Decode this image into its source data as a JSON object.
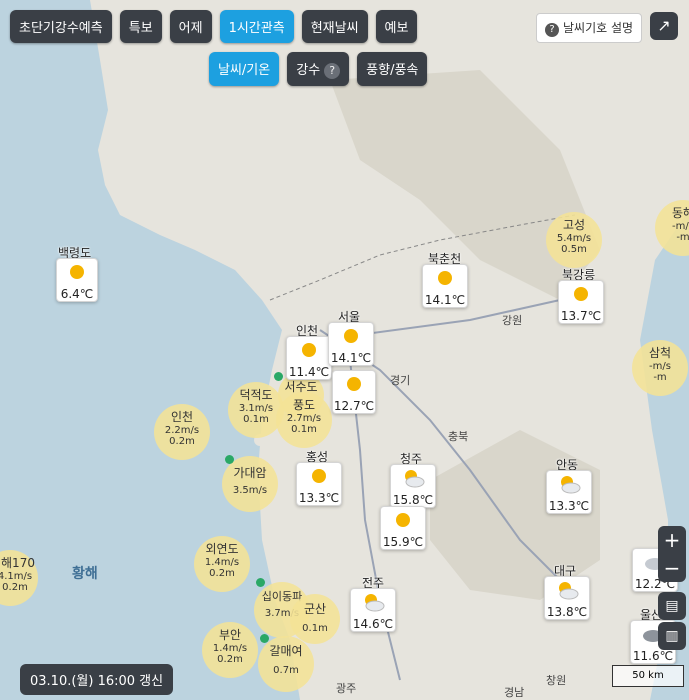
{
  "toolbar": {
    "buttons": [
      "초단기강수예측",
      "특보",
      "어제",
      "1시간관측",
      "현재날씨",
      "예보"
    ],
    "sub_buttons": [
      "날씨/기온",
      "강수",
      "풍향/풍속"
    ],
    "info_label": "날씨기호 설명"
  },
  "stations": [
    {
      "name": "백령도",
      "temp": "6.4℃",
      "icon": "sun-icon"
    },
    {
      "name": "인천",
      "temp": "11.4℃",
      "icon": "sun-icon"
    },
    {
      "name": "서울",
      "temp": "14.1℃",
      "icon": "sun-icon"
    },
    {
      "name": "",
      "temp": "12.7℃",
      "icon": "sun-icon"
    },
    {
      "name": "북춘천",
      "temp": "14.1℃",
      "icon": "sun-icon"
    },
    {
      "name": "북강릉",
      "temp": "13.7℃",
      "icon": "sun-icon"
    },
    {
      "name": "홍성",
      "temp": "13.3℃",
      "icon": "sun-icon"
    },
    {
      "name": "청주",
      "temp": "15.8℃",
      "icon": "partly-cloudy-icon"
    },
    {
      "name": "",
      "temp": "15.9℃",
      "icon": "sun-icon"
    },
    {
      "name": "안동",
      "temp": "13.3℃",
      "icon": "partly-cloudy-icon"
    },
    {
      "name": "전주",
      "temp": "14.6℃",
      "icon": "partly-cloudy-icon"
    },
    {
      "name": "대구",
      "temp": "13.8℃",
      "icon": "partly-cloudy-icon"
    },
    {
      "name": "",
      "temp": "12.2℃",
      "icon": "cloud-icon"
    },
    {
      "name": "울산",
      "temp": "11.6℃",
      "icon": "cloud-icon"
    }
  ],
  "wind": [
    {
      "name": "고성",
      "speed": "5.4",
      "unit": "m/s",
      "wave": "0.5m"
    },
    {
      "name": "동해",
      "speed": "-",
      "unit": "m/s",
      "wave": "-m"
    },
    {
      "name": "삼척",
      "speed": "-",
      "unit": "m/s",
      "wave": "-m"
    },
    {
      "name": "덕적도",
      "speed": "3.1",
      "unit": "m/s",
      "wave": "0.1m"
    },
    {
      "name": "서수도",
      "speed": "",
      "unit": "",
      "wave": ""
    },
    {
      "name": "풍도",
      "speed": "2.7",
      "unit": "m/s",
      "wave": "0.1m"
    },
    {
      "name": "인천",
      "speed": "2.2",
      "unit": "m/s",
      "wave": "0.2m"
    },
    {
      "name": "가대암",
      "speed": "3.5",
      "unit": "m/s",
      "wave": ""
    },
    {
      "name": "외연도",
      "speed": "1.4",
      "unit": "m/s",
      "wave": "0.2m"
    },
    {
      "name": "해170",
      "speed": "4.1",
      "unit": "m/s",
      "wave": "0.2m"
    },
    {
      "name": "십이동파",
      "speed": "3.7",
      "unit": "m/s",
      "wave": ""
    },
    {
      "name": "군산",
      "speed": "",
      "unit": "",
      "wave": "0.1m"
    },
    {
      "name": "부안",
      "speed": "1.4",
      "unit": "m/s",
      "wave": "0.2m"
    },
    {
      "name": "갈매여",
      "speed": "",
      "unit": "",
      "wave": "0.7m"
    }
  ],
  "map_labels": [
    "강원",
    "경기",
    "충북",
    "경남",
    "창원",
    "광주"
  ],
  "sea_label": "황해",
  "timestamp": "03.10.(월) 16:00 갱신",
  "scale_label": "50 km",
  "colors": {
    "active": "#1da0e0",
    "button": "#3a3f46",
    "buoy": "#f4e396"
  }
}
